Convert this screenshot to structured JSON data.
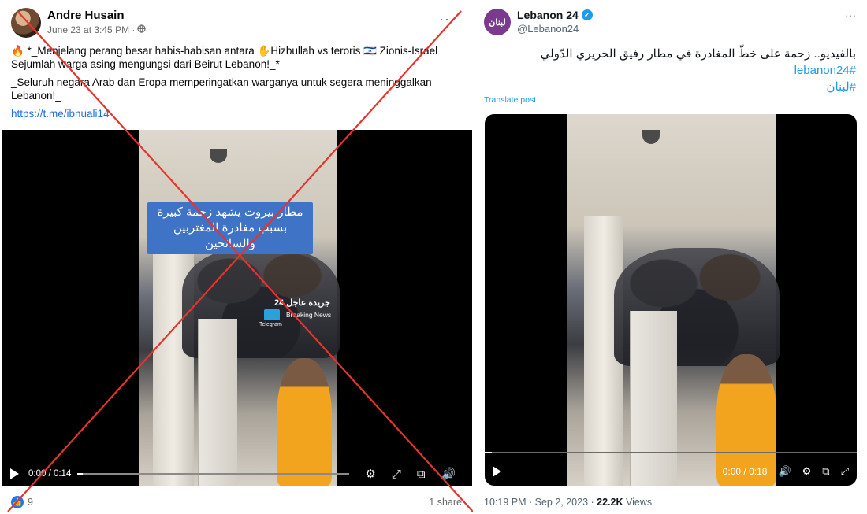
{
  "facebook_post": {
    "author": "Andre Husain",
    "timestamp": "June 23 at 3:45 PM ·",
    "more_icon": "ellipsis-icon",
    "paragraph1": "🔥 *_Menjelang perang besar habis-habisan antara ✋Hizbullah vs  teroris 🇮🇱 Zionis-Israel Sejumlah warga asing mengungsi dari Beirut Lebanon!_*",
    "paragraph2": "_Seluruh negara Arab dan Eropa memperingatkan warganya untuk segera meninggalkan Lebanon!_",
    "link": "https://t.me/ibnuali14",
    "video": {
      "overlay_caption": "مطار بيروت يشهد زحمة كبيرة بسبب مغادرة المغتربين والسائحين",
      "watermark": "جريدة عاجل 24",
      "watermark_sub": "Breaking News",
      "watermark_channel": "Telegram",
      "time": "0:00 / 0:14",
      "progress": 0.02,
      "control_icons": [
        "gear-icon",
        "expand-icon",
        "pip-icon",
        "volume-icon"
      ]
    },
    "likes": "9",
    "shares": "1 share",
    "crossed_out": true
  },
  "x_post": {
    "avatar_text": "لبنان",
    "name": "Lebanon 24",
    "handle": "@Lebanon24",
    "more_icon": "ellipsis-icon",
    "text": "بالفيديو.. زحمة على خطّ المغادرة في مطار رفيق الحريري الدّولي",
    "hashtag1": "#lebanon24",
    "hashtag2": "#لبنان",
    "translate": "Translate post",
    "video": {
      "time": "0:00 / 0:18",
      "progress": 0.02,
      "control_icons": [
        "volume-icon",
        "settings-icon",
        "pip-icon",
        "fullscreen-icon"
      ]
    },
    "footer_time": "10:19 PM · Sep 2, 2023 · ",
    "views_count": "22.2K",
    "views_label": " Views"
  },
  "colors": {
    "facebook_blue": "#1877f2",
    "x_blue": "#1d9bf0",
    "cross_red": "#e8322b",
    "overlay_blue": "#3f73c6"
  }
}
